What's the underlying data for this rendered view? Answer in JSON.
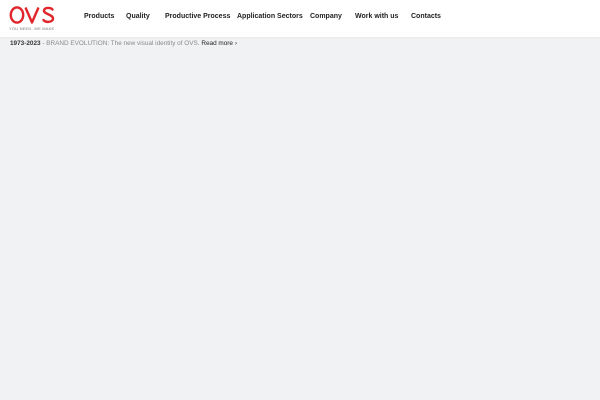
{
  "brand": {
    "logo_text": "OVS",
    "tagline": "YOU NEED, WE MAKE",
    "accent_color": "#e0252b"
  },
  "nav": {
    "items": [
      {
        "label": "Products"
      },
      {
        "label": "Quality"
      },
      {
        "label": "Productive Process"
      },
      {
        "label": "Application Sectors"
      },
      {
        "label": "Company"
      },
      {
        "label": "Work with us"
      },
      {
        "label": "Contacts"
      }
    ]
  },
  "announcement": {
    "years": "1973-2023",
    "separator": " - ",
    "text": "BRAND EVOLUTION: The new visual identity of OVS.",
    "link_label": "Read more",
    "arrow_icon": "chevron-right-icon",
    "arrow_glyph": "›"
  }
}
